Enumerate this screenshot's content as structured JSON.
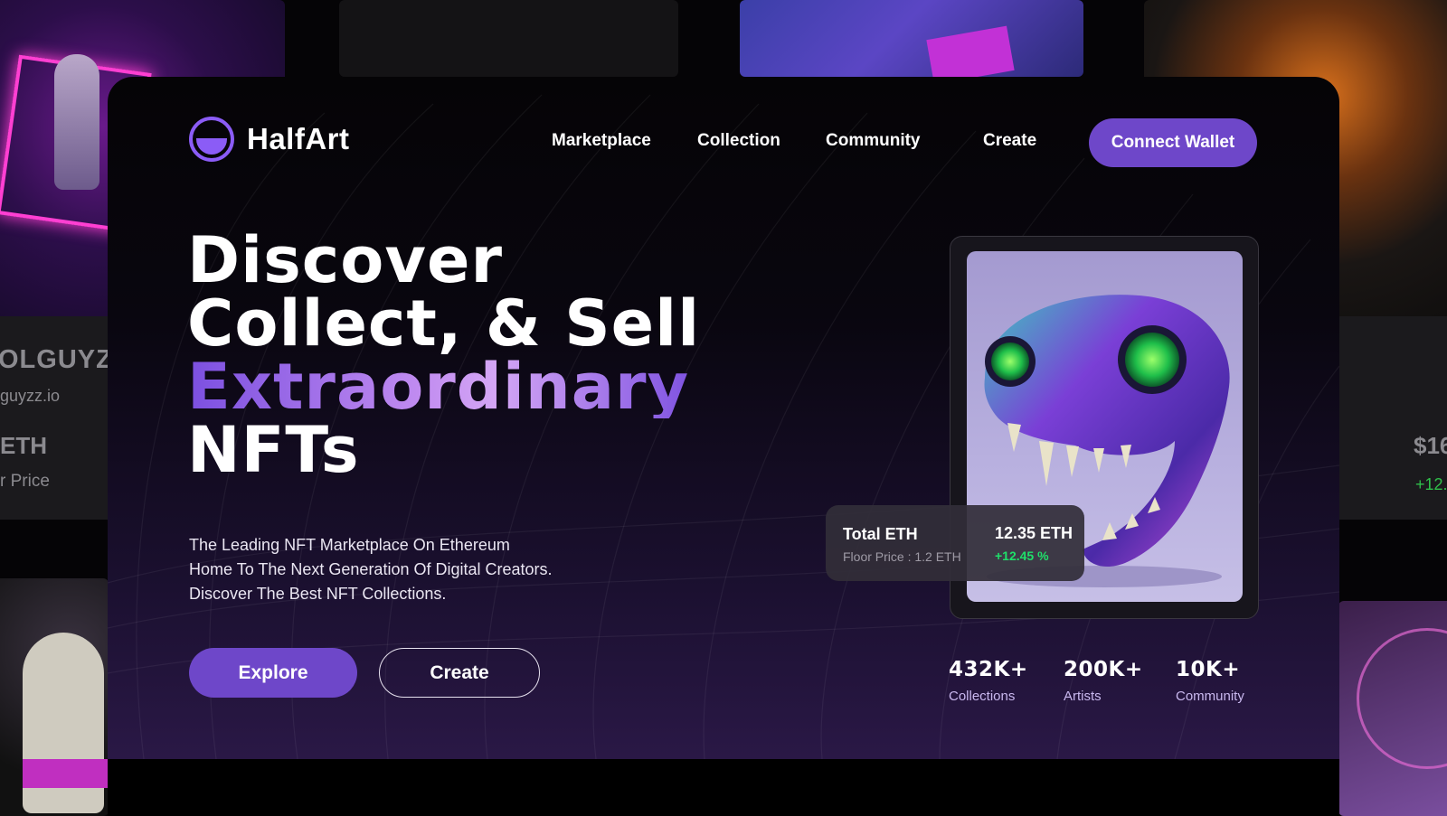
{
  "background_cards": {
    "left_name": "OLGUYZ",
    "left_handle": "guyzz.io",
    "left_price": "ETH",
    "left_floor": "r Price",
    "right_price": "$16",
    "right_change": "+12."
  },
  "brand": {
    "name": "HalfArt"
  },
  "nav": {
    "items": [
      "Marketplace",
      "Collection",
      "Community",
      "Create"
    ],
    "cta": "Connect Wallet"
  },
  "hero": {
    "line1": "Discover",
    "line2": "Collect, & Sell",
    "line3": "Extraordinary",
    "line4": "NFTs",
    "desc1": "The Leading NFT Marketplace On Ethereum",
    "desc2": "Home To The Next Generation Of Digital Creators.",
    "desc3": "Discover The Best NFT Collections.",
    "btn_primary": "Explore",
    "btn_secondary": "Create"
  },
  "featured": {
    "title": "Total ETH",
    "floor": "Floor Price : 1.2 ETH",
    "value": "12.35 ETH",
    "change": "+12.45 %"
  },
  "stats": [
    {
      "num": "432K+",
      "label": "Collections"
    },
    {
      "num": "200K+",
      "label": "Artists"
    },
    {
      "num": "10K+",
      "label": "Community"
    }
  ],
  "colors": {
    "accent": "#6e47c9",
    "positive": "#1fe06a"
  }
}
